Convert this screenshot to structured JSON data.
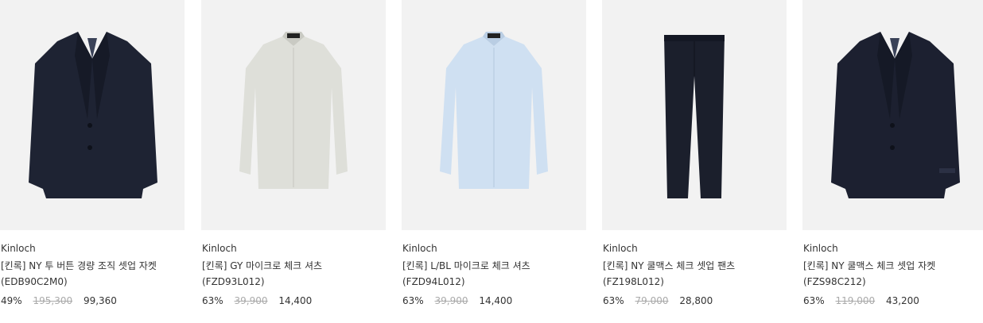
{
  "products": [
    {
      "brand": "Kinloch",
      "name": "[킨록] NY 투 버튼 경량 조직 셋업 자켓(EDB90C2M0)",
      "discount": "49%",
      "original_price": "195,300",
      "sale_price": "99,360",
      "image": "navy-jacket-icon",
      "color": "#1e2333"
    },
    {
      "brand": "Kinloch",
      "name": "[킨록] GY 마이크로 체크 셔츠 (FZD93L012)",
      "discount": "63%",
      "original_price": "39,900",
      "sale_price": "14,400",
      "image": "gray-shirt-icon",
      "color": "#dedfd9"
    },
    {
      "brand": "Kinloch",
      "name": "[킨록] L/BL 마이크로 체크 셔츠 (FZD94L012)",
      "discount": "63%",
      "original_price": "39,900",
      "sale_price": "14,400",
      "image": "lightblue-shirt-icon",
      "color": "#cfe0f2"
    },
    {
      "brand": "Kinloch",
      "name": "[킨록] NY 쿨맥스 체크 셋업 팬츠 (FZ198L012)",
      "discount": "63%",
      "original_price": "79,000",
      "sale_price": "28,800",
      "image": "navy-pants-icon",
      "color": "#1b1f2c"
    },
    {
      "brand": "Kinloch",
      "name": "[킨록] NY 쿨맥스 체크 셋업 자켓 (FZS98C212)",
      "discount": "63%",
      "original_price": "119,000",
      "sale_price": "43,200",
      "image": "navy-jacket-icon",
      "color": "#1c2030"
    }
  ]
}
